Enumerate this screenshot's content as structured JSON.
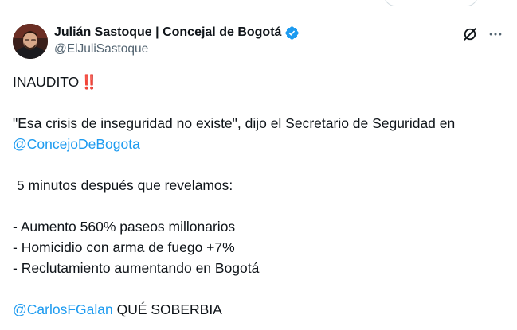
{
  "tweet": {
    "author": {
      "display_name": "Julián Sastoque | Concejal de Bogotá",
      "handle": "@ElJuliSastoque",
      "verified": true
    },
    "icons": {
      "grok": "grok-icon",
      "more": "more-icon",
      "verified": "verified-badge-icon",
      "emoji": "double-exclamation-icon"
    },
    "text": {
      "line1": "INAUDITO",
      "emoji": "‼️",
      "line2": "\"Esa crisis de inseguridad no existe\", dijo el Secretario de Seguridad en",
      "mention1": "@ConcejoDeBogota",
      "line3": " 5 minutos después que revelamos:",
      "bullet1": "- Aumento 560% paseos millonarios",
      "bullet2": "- Homicidio con arma de fuego +7%",
      "bullet3": "- Reclutamiento aumentando en Bogotá",
      "mention2": "@CarlosFGalan",
      "closing": " QUÉ SOBERBIA"
    },
    "colors": {
      "text": "#0f1419",
      "secondary": "#536471",
      "link": "#1d9bf0",
      "verified": "#1d9bf0"
    }
  }
}
